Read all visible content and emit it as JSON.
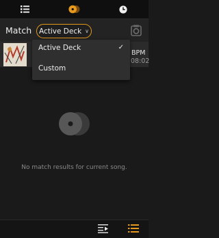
{
  "tabs": [
    {
      "name": "list-icon",
      "active": false
    },
    {
      "name": "match-icon",
      "active": true
    },
    {
      "name": "history-icon",
      "active": false
    }
  ],
  "header": {
    "title": "Match",
    "selector_value": "Active Deck",
    "camera_icon": "camera-icon"
  },
  "track": {
    "bpm": "BPM",
    "time": "08:02"
  },
  "dropdown": {
    "options": [
      {
        "label": "Active Deck",
        "selected": true
      },
      {
        "label": "Custom",
        "selected": false
      }
    ]
  },
  "empty_state": {
    "message": "No match results for current song."
  },
  "bottom": {
    "left_icon": "add-to-queue-icon",
    "right_icon": "list-view-icon"
  },
  "colors": {
    "accent": "#e69a1c",
    "background": "#1a1a1a"
  }
}
